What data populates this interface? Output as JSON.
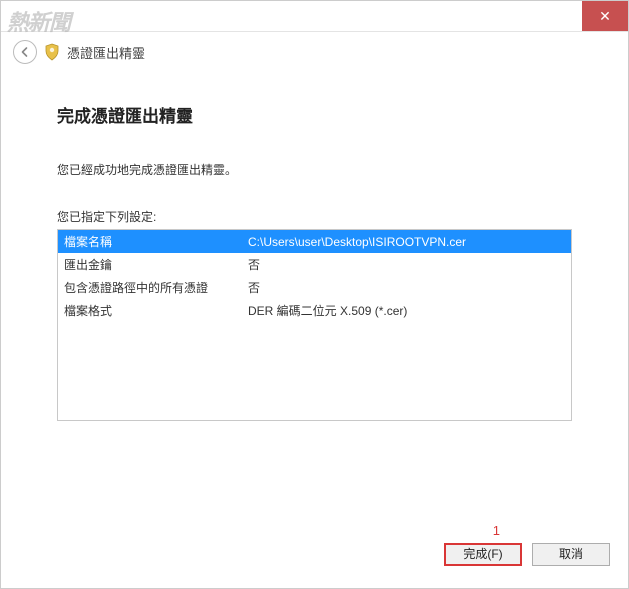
{
  "window": {
    "close_symbol": "✕"
  },
  "wizard": {
    "title": "憑證匯出精靈",
    "page_heading": "完成憑證匯出精靈",
    "success_message": "您已經成功地完成憑證匯出精靈。",
    "settings_label": "您已指定下列設定:"
  },
  "settings_rows": [
    {
      "key": "檔案名稱",
      "value": "C:\\Users\\user\\Desktop\\ISIROOTVPN.cer",
      "selected": true
    },
    {
      "key": "匯出金鑰",
      "value": "否",
      "selected": false
    },
    {
      "key": "包含憑證路徑中的所有憑證",
      "value": "否",
      "selected": false
    },
    {
      "key": "檔案格式",
      "value": "DER 編碼二位元 X.509 (*.cer)",
      "selected": false
    }
  ],
  "buttons": {
    "finish": "完成(F)",
    "cancel": "取消"
  },
  "annotation": {
    "num": "1"
  },
  "watermark": "熱新聞"
}
